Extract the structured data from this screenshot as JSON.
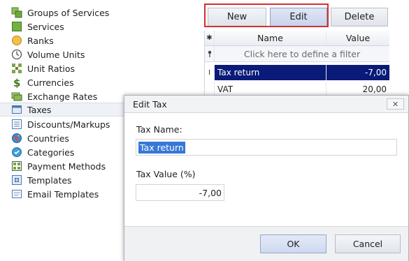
{
  "sidebar": {
    "items": [
      {
        "label": "Groups of Services",
        "icon": "groups-of-services-icon",
        "selected": false
      },
      {
        "label": "Services",
        "icon": "services-icon",
        "selected": false
      },
      {
        "label": "Ranks",
        "icon": "ranks-icon",
        "selected": false
      },
      {
        "label": "Volume Units",
        "icon": "volume-units-icon",
        "selected": false
      },
      {
        "label": "Unit Ratios",
        "icon": "unit-ratios-icon",
        "selected": false
      },
      {
        "label": "Currencies",
        "icon": "currencies-icon",
        "selected": false
      },
      {
        "label": "Exchange Rates",
        "icon": "exchange-rates-icon",
        "selected": false
      },
      {
        "label": "Taxes",
        "icon": "taxes-icon",
        "selected": true
      },
      {
        "label": "Discounts/Markups",
        "icon": "discounts-markups-icon",
        "selected": false
      },
      {
        "label": "Countries",
        "icon": "countries-icon",
        "selected": false
      },
      {
        "label": "Categories",
        "icon": "categories-icon",
        "selected": false
      },
      {
        "label": "Payment Methods",
        "icon": "payment-methods-icon",
        "selected": false
      },
      {
        "label": "Templates",
        "icon": "templates-icon",
        "selected": false
      },
      {
        "label": "Email Templates",
        "icon": "email-templates-icon",
        "selected": false
      }
    ]
  },
  "toolbar": {
    "new_label": "New",
    "edit_label": "Edit",
    "delete_label": "Delete",
    "highlight_color": "#d42f2f"
  },
  "grid": {
    "columns": {
      "name": "Name",
      "value": "Value"
    },
    "filter_text": "Click here to define a filter",
    "rows": [
      {
        "name": "Tax return",
        "value": "-7,00",
        "selected": true
      },
      {
        "name": "VAT",
        "value": "20,00",
        "selected": false
      }
    ]
  },
  "dialog": {
    "title": "Edit Tax",
    "close_glyph": "✕",
    "tax_name_label": "Tax Name:",
    "tax_name_value": "Tax return",
    "tax_value_label": "Tax Value (%)",
    "tax_value_value": "-7,00",
    "ok_label": "OK",
    "cancel_label": "Cancel"
  },
  "colors": {
    "selected_row": "#0a1a78",
    "text_selection": "#3778d6"
  }
}
